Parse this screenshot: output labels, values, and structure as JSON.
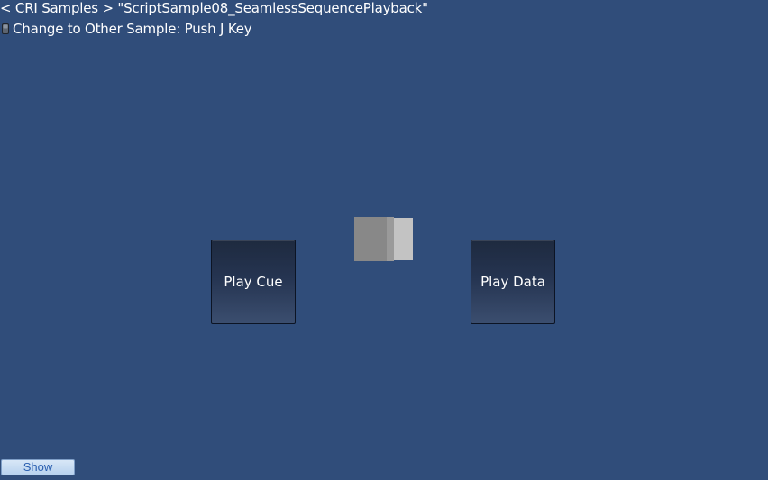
{
  "header": {
    "breadcrumb": "< CRI Samples > \"ScriptSample08_SeamlessSequencePlayback\"",
    "instruction": "Change to Other Sample: Push J Key",
    "instruction_icon": "keyboard-key-icon"
  },
  "buttons": {
    "play_cue_label": "Play Cue",
    "play_data_label": "Play Data",
    "show_label": "Show"
  },
  "colors": {
    "background": "#304d7a",
    "button_text": "#ffffff",
    "show_button_text": "#2a5fb0"
  }
}
